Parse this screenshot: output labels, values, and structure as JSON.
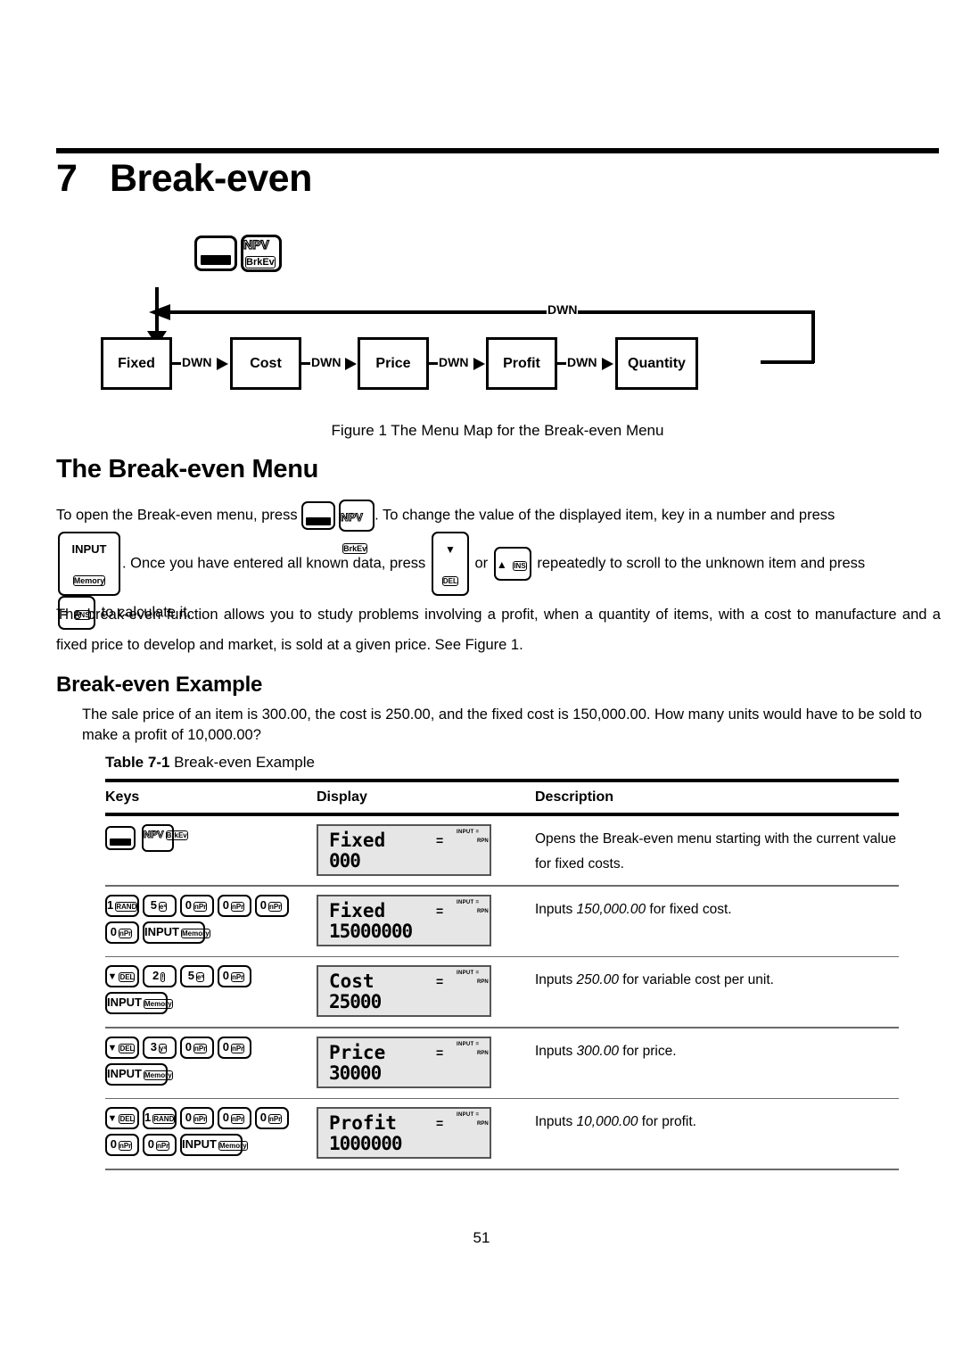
{
  "chapter": {
    "number": "7",
    "title": "Break-even"
  },
  "figure": {
    "caption": "Figure 1 The Menu Map for the Break-even Menu",
    "open_keys": {
      "shift": "shift-key",
      "npv_top": "NPV",
      "npv_bottom": "BrkEv"
    },
    "boxes": [
      "Fixed",
      "Cost",
      "Price",
      "Profit",
      "Quantity"
    ],
    "arrow_label": "DWN",
    "loop_label": "DWN"
  },
  "sections": {
    "menu_heading": "The Break-even Menu",
    "example_heading": "Break-even Example"
  },
  "intro": {
    "p1_a": "To open the Break-even menu, press",
    "p1_b": ". To change the value of the displayed item, key in a number and press",
    "p1_c": ". Once you have entered all known data, press",
    "p1_or": "or",
    "p1_d": "repeatedly to scroll to the unknown item and press",
    "p1_e": "to calculate it.",
    "p2": "The break-even function allows you to study problems involving a profit, when a quantity of items, with a cost to manufacture and a fixed price to develop and market, is sold at a given price. See Figure 1."
  },
  "example": {
    "problem": "The sale price of an item is 300.00, the cost is 250.00, and the fixed cost is 150,000.00. How many units would have to be sold to make a profit of 10,000.00?"
  },
  "table": {
    "label": "Table 7-1",
    "title": "Break-even Example",
    "columns": [
      "Keys",
      "Display",
      "Description"
    ],
    "rows": [
      {
        "keys": [
          {
            "type": "shift"
          },
          {
            "type": "npv",
            "top": "NPV",
            "bottom": "BrkEv"
          }
        ],
        "display": {
          "word": "Fixed",
          "value": "000",
          "eq": "=",
          "ind1": "INPUT =",
          "ind2": "RPN"
        },
        "description": "Opens the Break-even menu starting with the current value for fixed costs.",
        "desc_parts": [
          {
            "text": "Opens the Break-even menu starting with the current value for fixed costs.",
            "italic": false
          }
        ]
      },
      {
        "keys": [
          {
            "type": "key",
            "top": "1",
            "bottom": "RAND"
          },
          {
            "type": "key",
            "top": "5",
            "bottom": "eˣ"
          },
          {
            "type": "key",
            "top": "0",
            "bottom": "nPr"
          },
          {
            "type": "key",
            "top": "0",
            "bottom": "nPr"
          },
          {
            "type": "key",
            "top": "0",
            "bottom": "nPr"
          },
          {
            "type": "key",
            "top": "0",
            "bottom": "nPr"
          },
          {
            "type": "key",
            "top": "INPUT",
            "bottom": "Memory",
            "wide": true
          }
        ],
        "display": {
          "word": "Fixed",
          "value": "15000000",
          "eq": "=",
          "ind1": "INPUT =",
          "ind2": "RPN"
        },
        "desc_parts": [
          {
            "text": "Inputs ",
            "italic": false
          },
          {
            "text": "150,000.00",
            "italic": true
          },
          {
            "text": " for fixed cost.",
            "italic": false
          }
        ]
      },
      {
        "keys": [
          {
            "type": "key",
            "top": "▼",
            "bottom": "DEL",
            "isarrow": true
          },
          {
            "type": "key",
            "top": "2",
            "bottom": "!"
          },
          {
            "type": "key",
            "top": "5",
            "bottom": "eˣ"
          },
          {
            "type": "key",
            "top": "0",
            "bottom": "nPr"
          },
          {
            "type": "key",
            "top": "INPUT",
            "bottom": "Memory",
            "wide": true
          }
        ],
        "display": {
          "word": "Cost",
          "value": "25000",
          "eq": "=",
          "ind1": "INPUT =",
          "ind2": "RPN"
        },
        "desc_parts": [
          {
            "text": "Inputs ",
            "italic": false
          },
          {
            "text": "250.00",
            "italic": true
          },
          {
            "text": " for variable cost per unit.",
            "italic": false
          }
        ]
      },
      {
        "keys": [
          {
            "type": "key",
            "top": "▼",
            "bottom": "DEL",
            "isarrow": true
          },
          {
            "type": "key",
            "top": "3",
            "bottom": "yˣ"
          },
          {
            "type": "key",
            "top": "0",
            "bottom": "nPr"
          },
          {
            "type": "key",
            "top": "0",
            "bottom": "nPr"
          },
          {
            "type": "key",
            "top": "INPUT",
            "bottom": "Memory",
            "wide": true
          }
        ],
        "display": {
          "word": "Price",
          "value": "30000",
          "eq": "=",
          "ind1": "INPUT =",
          "ind2": "RPN"
        },
        "desc_parts": [
          {
            "text": "Inputs ",
            "italic": false
          },
          {
            "text": "300.00",
            "italic": true
          },
          {
            "text": " for price.",
            "italic": false
          }
        ]
      },
      {
        "keys": [
          {
            "type": "key",
            "top": "▼",
            "bottom": "DEL",
            "isarrow": true
          },
          {
            "type": "key",
            "top": "1",
            "bottom": "RAND"
          },
          {
            "type": "key",
            "top": "0",
            "bottom": "nPr"
          },
          {
            "type": "key",
            "top": "0",
            "bottom": "nPr"
          },
          {
            "type": "key",
            "top": "0",
            "bottom": "nPr"
          },
          {
            "type": "key",
            "top": "0",
            "bottom": "nPr"
          },
          {
            "type": "key",
            "top": "0",
            "bottom": "nPr"
          },
          {
            "type": "key",
            "top": "INPUT",
            "bottom": "Memory",
            "wide": true
          }
        ],
        "display": {
          "word": "Profit",
          "value": "1000000",
          "eq": "=",
          "ind1": "INPUT =",
          "ind2": "RPN"
        },
        "desc_parts": [
          {
            "text": "Inputs ",
            "italic": false
          },
          {
            "text": "10,000.00",
            "italic": true
          },
          {
            "text": " for profit.",
            "italic": false
          }
        ]
      }
    ]
  },
  "inline_keys": {
    "input": {
      "top": "INPUT",
      "bottom": "Memory"
    },
    "down": {
      "top": "▼",
      "bottom": "DEL"
    },
    "up": {
      "top": "▲",
      "bottom": "INS"
    },
    "equals": {
      "top": "=",
      "bottom": "ANS"
    }
  },
  "footer": {
    "page_number": "51"
  }
}
